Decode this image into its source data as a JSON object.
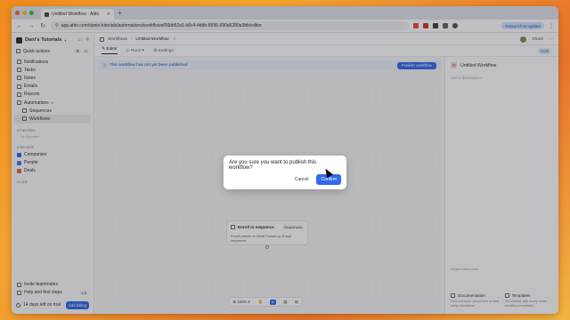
{
  "browser": {
    "tab_title": "Untitled Workflow · Attio",
    "url": "app.attio.com/danis-tutorials/automations/workflows/06bb52a1-b6c4-4ddb-8996-990a6280a9bb/editor",
    "relaunch": "Relaunch to update"
  },
  "sidebar": {
    "workspace": "Dani's Tutorials",
    "quick_actions": "Quick actions",
    "kbd1": "⌘",
    "kbd2": "K",
    "items": [
      {
        "label": "Notifications",
        "icon": "bell-icon"
      },
      {
        "label": "Tasks",
        "icon": "check-icon"
      },
      {
        "label": "Notes",
        "icon": "note-icon"
      },
      {
        "label": "Emails",
        "icon": "mail-icon"
      },
      {
        "label": "Reports",
        "icon": "chart-icon"
      },
      {
        "label": "Automations",
        "icon": "bolt-icon"
      },
      {
        "label": "Sequences",
        "icon": "sequence-icon"
      },
      {
        "label": "Workflows",
        "icon": "workflow-icon"
      }
    ],
    "favorites_header": "Favorites",
    "favorites_empty": "No favorites",
    "records_header": "Records",
    "records": [
      {
        "label": "Companies",
        "color": "#2f6bea"
      },
      {
        "label": "People",
        "color": "#3f7bea"
      },
      {
        "label": "Deals",
        "color": "#e0663a"
      }
    ],
    "lists_header": "Lists",
    "invite": "Invite teammates",
    "help": "Help and first steps",
    "help_progress": "1/6",
    "trial": "14 days left on trial",
    "add_billing": "Add billing"
  },
  "topbar": {
    "crumb_root": "Workflows",
    "crumb_current": "Untitled Workflow",
    "share": "Share"
  },
  "tabs": [
    "Editor",
    "Runs",
    "Settings"
  ],
  "draft": "Draft",
  "banner": {
    "text": "This workflow has not yet been published",
    "button": "Publish workflow"
  },
  "canvas": {
    "trigger_label": "Trigger",
    "node_title": "Enroll in sequence",
    "node_tag": "Sequences",
    "node_desc": "Enroll person in Initial Follow-up Email sequence",
    "zoom": "100%"
  },
  "right_panel": {
    "title": "Untitled Workflow",
    "description_placeholder": "Add a description...",
    "help_header": "Helpful resources",
    "card1_title": "Documentation",
    "card1_sub": "Find out more about how to best setup workflows",
    "card2_title": "Templates",
    "card2_sub": "Get started with ready-made workflow templates"
  },
  "dialog": {
    "question": "Are you sure you want to publish this workflow?",
    "cancel": "Cancel",
    "confirm": "Confirm"
  }
}
